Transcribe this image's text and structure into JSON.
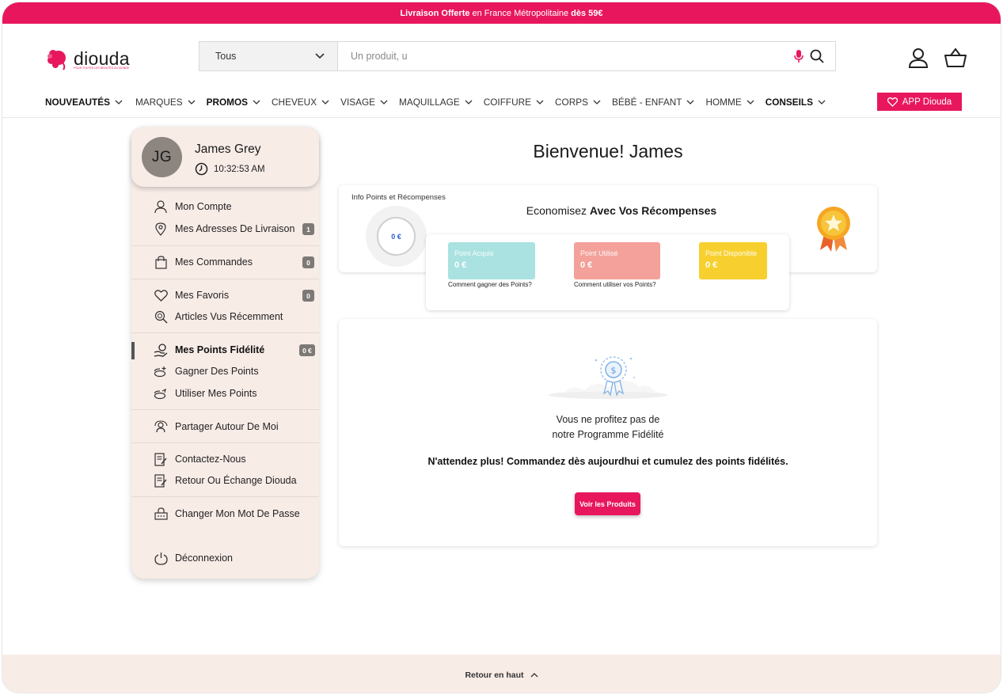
{
  "promo_bar": {
    "part1": "Livraison Offerte",
    "part2": "en France Métropolitaine",
    "part3": "dès 59€",
    "color": "#e8175d"
  },
  "brand": {
    "name": "diouda",
    "tagline": "POUR TOUTES LES BEAUTÉS DU MONDE"
  },
  "search": {
    "category": "Tous",
    "placeholder": "Un produit, u"
  },
  "nav": {
    "items": [
      {
        "label": "NOUVEAUTÉS",
        "bold": true
      },
      {
        "label": "MARQUES",
        "bold": false
      },
      {
        "label": "PROMOS",
        "bold": true
      },
      {
        "label": "CHEVEUX",
        "bold": false
      },
      {
        "label": "VISAGE",
        "bold": false
      },
      {
        "label": "MAQUILLAGE",
        "bold": false
      },
      {
        "label": "COIFFURE",
        "bold": false
      },
      {
        "label": "CORPS",
        "bold": false
      },
      {
        "label": "BÉBÉ - ENFANT",
        "bold": false
      },
      {
        "label": "HOMME",
        "bold": false
      },
      {
        "label": "CONSEILS",
        "bold": true
      }
    ],
    "app_button": "APP Diouda"
  },
  "user": {
    "initials": "JG",
    "name": "James Grey",
    "time": "10:32:53 AM"
  },
  "sidebar": {
    "mon_compte": "Mon Compte",
    "adresses": "Mes Adresses De Livraison",
    "adresses_count": "1",
    "commandes": "Mes Commandes",
    "commandes_count": "0",
    "favoris": "Mes Favoris",
    "favoris_count": "0",
    "vus": "Articles Vus Récemment",
    "points": "Mes Points Fidélité",
    "points_badge": "0 €",
    "gagner": "Gagner Des Points",
    "utiliser": "Utiliser Mes Points",
    "partager": "Partager Autour De Moi",
    "contact": "Contactez-Nous",
    "retour": "Retour Ou Échange Diouda",
    "mdp": "Changer Mon Mot De Passe",
    "logout": "Déconnexion"
  },
  "main": {
    "welcome": "Bienvenue! James",
    "info_label": "Info Points et Récompenses",
    "headline_plain": "Economisez",
    "headline_bold": "Avec Vos Récompenses",
    "ring_value": "0 €",
    "tiles": [
      {
        "label": "Point Acquis",
        "value": "0 €",
        "link": "Comment gagner des Points?",
        "color": "#a9e2e0"
      },
      {
        "label": "Point Utilisé",
        "value": "0 €",
        "link": "Comment utiliser vos Points?",
        "color": "#f3a19a"
      },
      {
        "label": "Point Disponible",
        "value": "0 €",
        "link": "",
        "color": "#f7d02f"
      }
    ],
    "msg_line1": "Vous ne profitez pas de",
    "msg_line2": "notre Programme Fidélité",
    "msg_bold": "N'attendez plus! Commandez dès aujourdhui et cumulez des points fidélités.",
    "cta": "Voir les Produits"
  },
  "footer": {
    "back_to_top": "Retour en haut"
  }
}
